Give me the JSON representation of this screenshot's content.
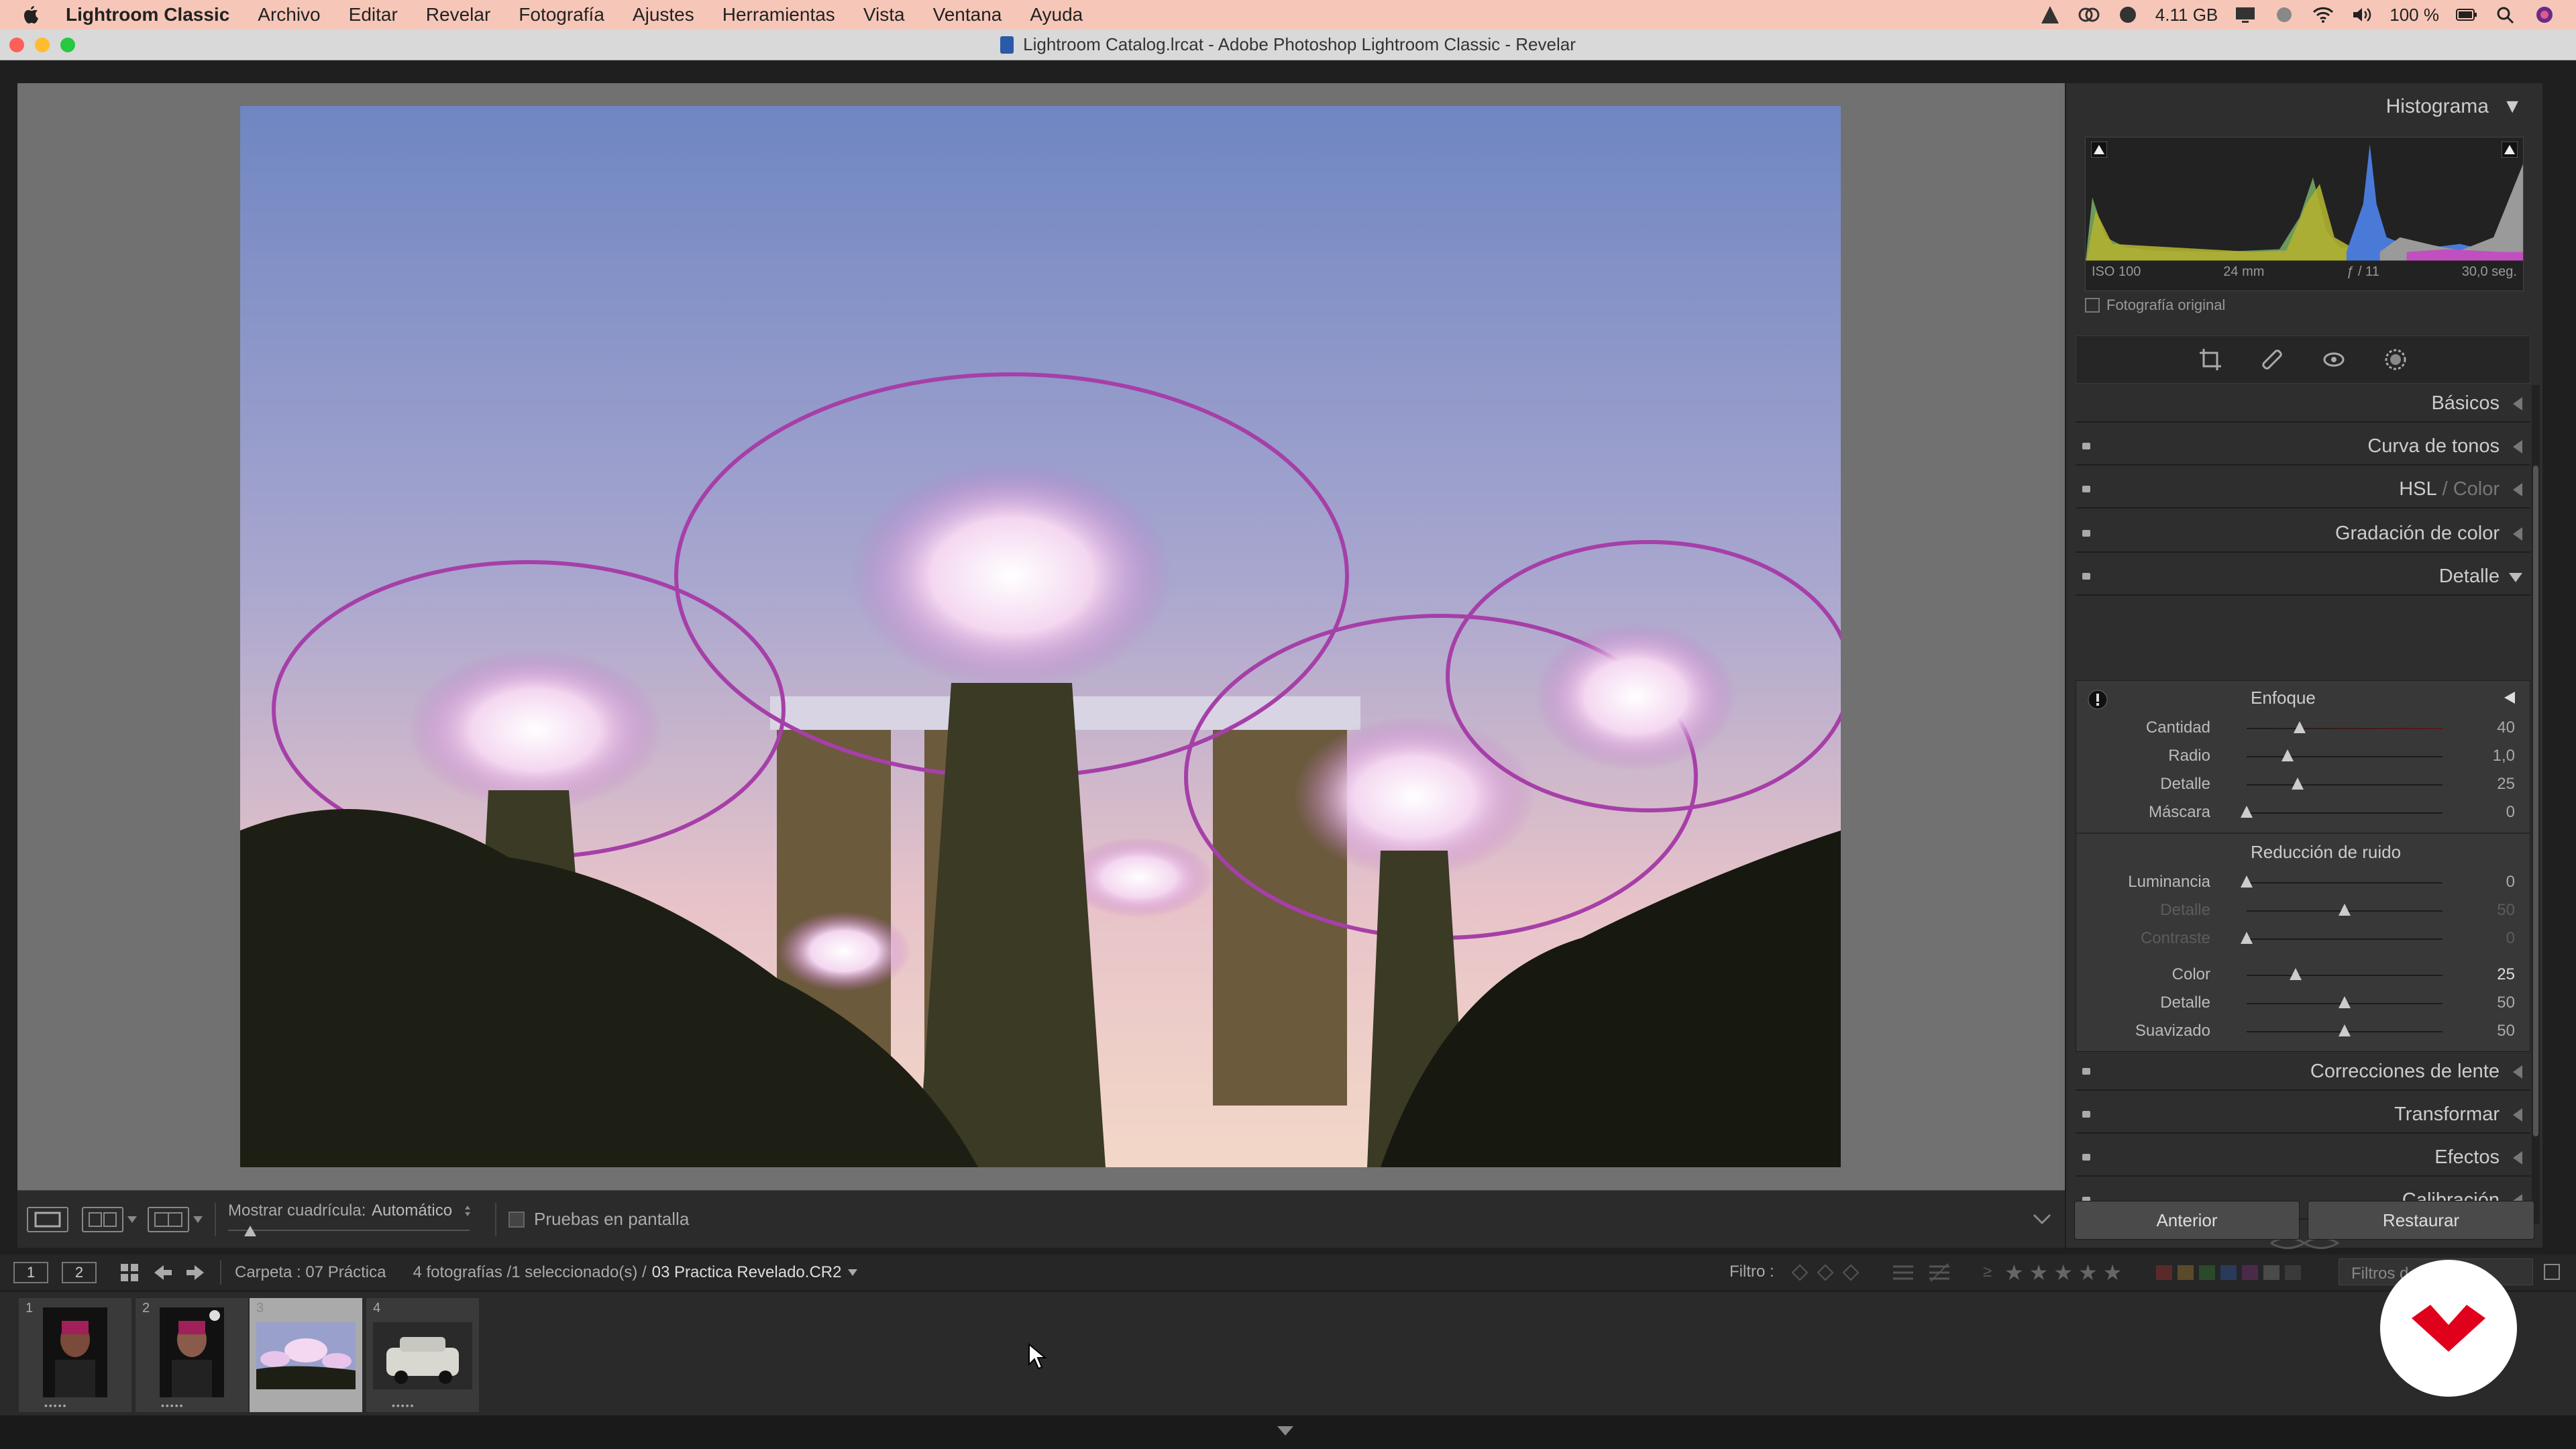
{
  "menubar": {
    "app_name": "Lightroom Classic",
    "items": [
      "Archivo",
      "Editar",
      "Revelar",
      "Fotografía",
      "Ajustes",
      "Herramientas",
      "Vista",
      "Ventana",
      "Ayuda"
    ],
    "memory": "4.11 GB",
    "battery": "100 %"
  },
  "window": {
    "title": "Lightroom Catalog.lrcat - Adobe Photoshop Lightroom Classic - Revelar"
  },
  "toolbar": {
    "grid_label": "Mostrar cuadrícula:",
    "grid_value": "Automático",
    "softproof_label": "Pruebas en pantalla"
  },
  "panel": {
    "histogram_title": "Histograma",
    "exif": {
      "iso": "ISO 100",
      "focal": "24 mm",
      "aperture": "ƒ / 11",
      "shutter": "30,0 seg."
    },
    "original_label": "Fotografía original",
    "sections": {
      "basicos": "Básicos",
      "curva": "Curva de tonos",
      "hsl": "HSL",
      "hsl_sep": "/",
      "hsl_color": "Color",
      "gradacion": "Gradación de color",
      "detalle": "Detalle",
      "correcciones": "Correcciones de lente",
      "transformar": "Transformar",
      "efectos": "Efectos",
      "calibracion": "Calibración"
    },
    "enfoque": {
      "title": "Enfoque",
      "rows": [
        {
          "label": "Cantidad",
          "value": "40",
          "pos": 0.27
        },
        {
          "label": "Radio",
          "value": "1,0",
          "pos": 0.21
        },
        {
          "label": "Detalle",
          "value": "25",
          "pos": 0.26
        },
        {
          "label": "Máscara",
          "value": "0",
          "pos": 0.0
        }
      ]
    },
    "ruido": {
      "title": "Reducción de ruido",
      "rows": [
        {
          "label": "Luminancia",
          "value": "0",
          "pos": 0.0
        },
        {
          "label": "Detalle",
          "value": "50",
          "pos": 0.5
        },
        {
          "label": "Contraste",
          "value": "0",
          "pos": 0.0
        },
        {
          "label": "Color",
          "value": "25",
          "pos": 0.25
        },
        {
          "label": "Detalle",
          "value": "50",
          "pos": 0.5
        },
        {
          "label": "Suavizado",
          "value": "50",
          "pos": 0.5
        }
      ]
    },
    "prev_button": "Anterior",
    "reset_button": "Restaurar"
  },
  "filmbar": {
    "page1": "1",
    "page2": "2",
    "folder": "Carpeta : 07 Práctica",
    "count": "4 fotografías /1 seleccionado(s) /",
    "file": "03 Practica Revelado.CR2",
    "filter_label": "Filtro :",
    "filters_off": "Filtros d"
  },
  "filmstrip": {
    "numbers": [
      "1",
      "2",
      "3",
      "4"
    ]
  },
  "colors": {
    "menubar": "#f6c7b8",
    "accent": "#e0001b"
  }
}
